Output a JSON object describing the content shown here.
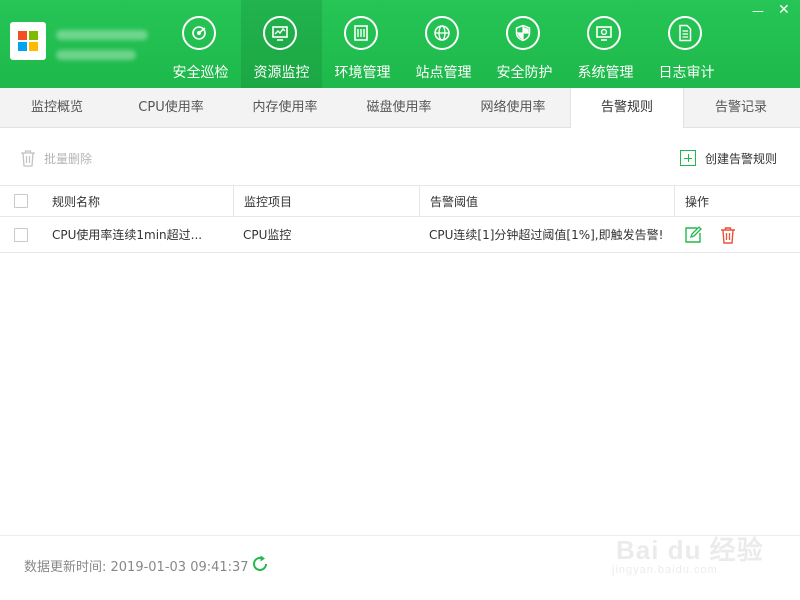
{
  "header": {
    "nav": [
      {
        "label": "安全巡检",
        "icon": "radar-icon"
      },
      {
        "label": "资源监控",
        "icon": "monitor-chart-icon"
      },
      {
        "label": "环境管理",
        "icon": "server-icon"
      },
      {
        "label": "站点管理",
        "icon": "globe-icon"
      },
      {
        "label": "安全防护",
        "icon": "shield-icon"
      },
      {
        "label": "系统管理",
        "icon": "settings-monitor-icon"
      },
      {
        "label": "日志审计",
        "icon": "document-icon"
      }
    ],
    "active_nav": 1,
    "minimize_label": "—",
    "close_label": "✕"
  },
  "tabs": {
    "items": [
      "监控概览",
      "CPU使用率",
      "内存使用率",
      "磁盘使用率",
      "网络使用率",
      "告警规则",
      "告警记录"
    ],
    "active": 5
  },
  "toolbar": {
    "batch_delete_label": "批量删除",
    "create_rule_label": "创建告警规则"
  },
  "table": {
    "columns": {
      "name": "规则名称",
      "item": "监控项目",
      "threshold": "告警阈值",
      "ops": "操作"
    },
    "rows": [
      {
        "name": "CPU使用率连续1min超过...",
        "item": "CPU监控",
        "threshold": "CPU连续[1]分钟超过阈值[1%],即触发告警!"
      }
    ]
  },
  "footer": {
    "update_time": "数据更新时间: 2019-01-03 09:41:37"
  },
  "watermark": {
    "main": "Bai du 经验",
    "sub": "jingyan.baidu.com"
  },
  "colors": {
    "brand_green": "#21b94c",
    "delete_red": "#e8543c"
  }
}
